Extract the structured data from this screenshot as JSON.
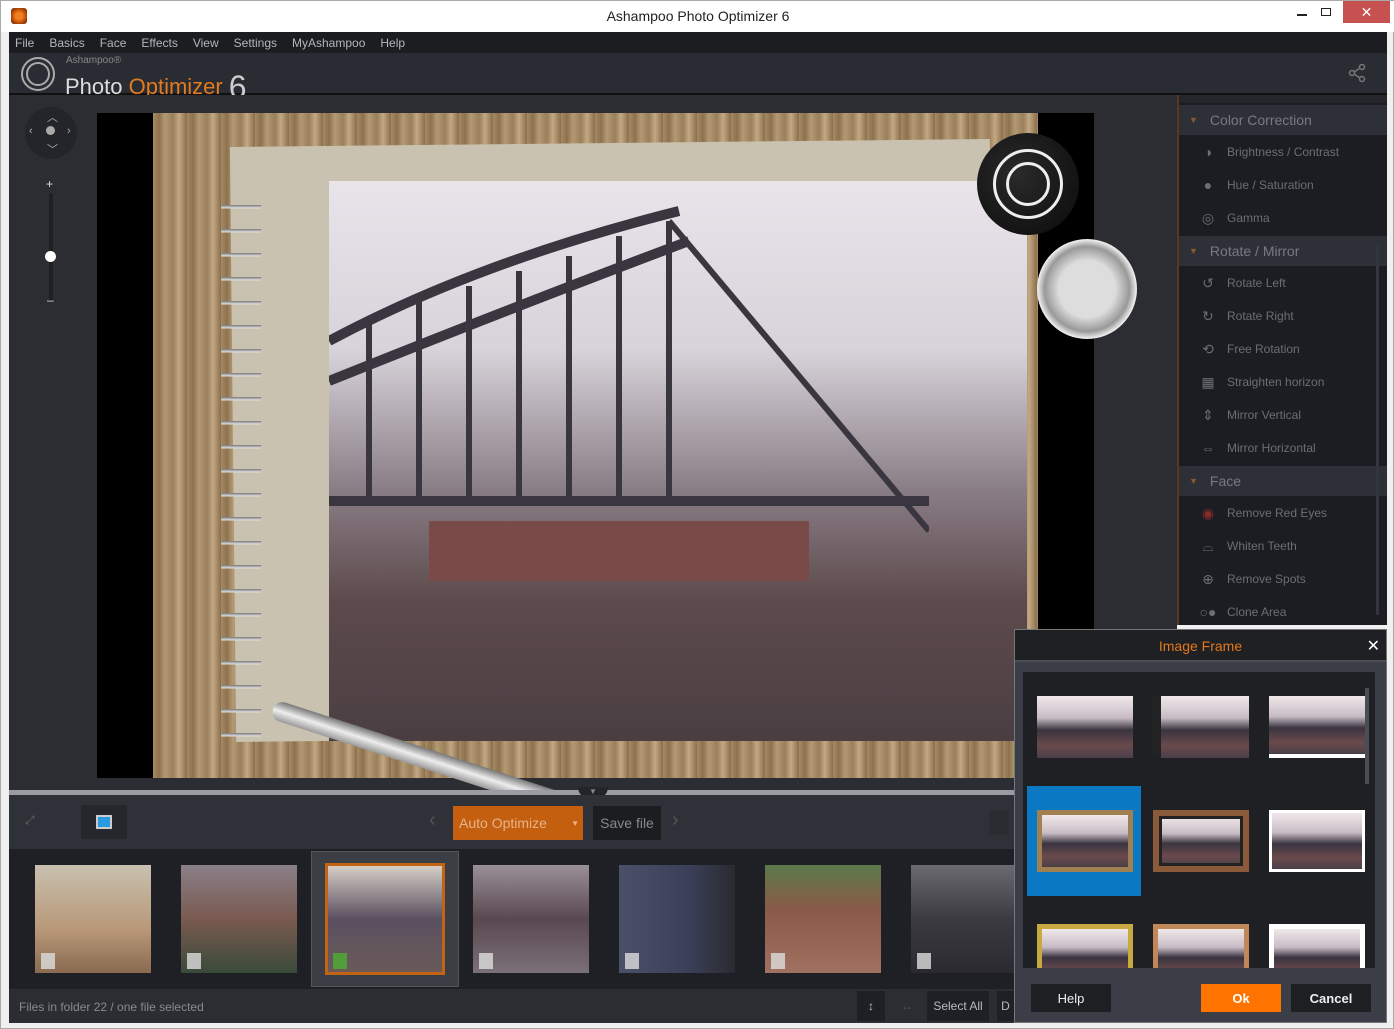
{
  "window": {
    "title": "Ashampoo Photo Optimizer 6",
    "controls": {
      "minimize": "minimize",
      "maximize": "maximize",
      "close": "✕"
    }
  },
  "menu": [
    "File",
    "Basics",
    "Face",
    "Effects",
    "View",
    "Settings",
    "MyAshampoo",
    "Help"
  ],
  "brand": {
    "vendor": "Ashampoo®",
    "name_a": "Photo",
    "name_b": "Optimizer",
    "version": "6"
  },
  "sidebar": {
    "sections": [
      {
        "label": "Color Correction",
        "items": [
          {
            "label": "Brightness / Contrast",
            "icon": "brightness-icon"
          },
          {
            "label": "Hue / Saturation",
            "icon": "hue-icon"
          },
          {
            "label": "Gamma",
            "icon": "gamma-icon"
          }
        ]
      },
      {
        "label": "Rotate / Mirror",
        "items": [
          {
            "label": "Rotate Left",
            "icon": "rotate-left-icon"
          },
          {
            "label": "Rotate Right",
            "icon": "rotate-right-icon"
          },
          {
            "label": "Free Rotation",
            "icon": "free-rotation-icon"
          },
          {
            "label": "Straighten horizon",
            "icon": "straighten-icon"
          },
          {
            "label": "Mirror Vertical",
            "icon": "mirror-vertical-icon"
          },
          {
            "label": "Mirror Horizontal",
            "icon": "mirror-horizontal-icon"
          }
        ]
      },
      {
        "label": "Face",
        "items": [
          {
            "label": "Remove Red Eyes",
            "icon": "red-eye-icon"
          },
          {
            "label": "Whiten Teeth",
            "icon": "tooth-icon"
          },
          {
            "label": "Remove Spots",
            "icon": "spots-icon"
          },
          {
            "label": "Clone Area",
            "icon": "clone-icon"
          }
        ]
      }
    ]
  },
  "toolbar": {
    "auto_optimize": "Auto Optimize",
    "save_file": "Save file"
  },
  "filmstrip": {
    "count": 7,
    "selected_index": 2
  },
  "status": {
    "text": "Files in folder 22 / one file selected",
    "select_all": "Select All",
    "deselect_partial": "D"
  },
  "dialog": {
    "title": "Image Frame",
    "selected_frame": 3,
    "frames_visible": 9,
    "buttons": {
      "help": "Help",
      "ok": "Ok",
      "cancel": "Cancel"
    }
  },
  "zoom": {
    "level_fraction": 0.35
  },
  "colors": {
    "accent": "#e2781c",
    "ok_button": "#ff7300",
    "selection_blue": "#0a78c2"
  }
}
